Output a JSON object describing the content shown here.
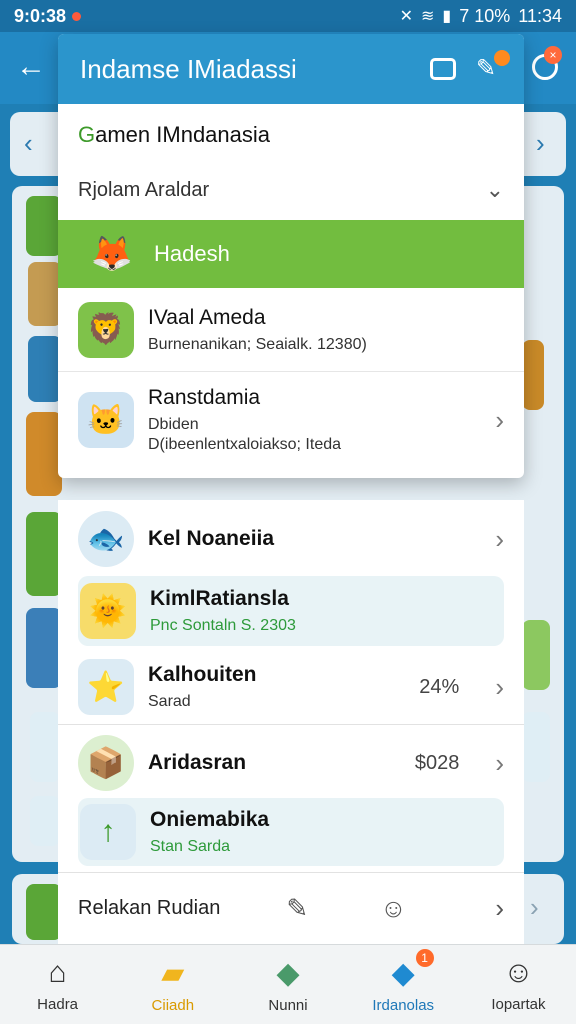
{
  "status_bar": {
    "time_left": "9:0:38",
    "battery": "7 10%",
    "time_right": "11:34",
    "notification_dot_color": "#ff5a3c"
  },
  "header": {
    "title": "Indamse IMiadassi"
  },
  "modal": {
    "subtitle_first": "G",
    "subtitle_rest": "amen IMndanasia",
    "dropdown_label": "Rjolam Araldar",
    "selected_row": {
      "label": "Hadesh",
      "icon": "fox-character-icon"
    },
    "rows": [
      {
        "title": "IVaal Ameda",
        "subtitle": "Burnenanikan; Seaialk. 12380)",
        "icon": "lion-character-icon",
        "bg": "#7fc24a"
      },
      {
        "title": "Ranstdamia",
        "subtitle": "Dbiden",
        "subtitle2": "D(ibeenlentxaloiakso; Iteda",
        "icon": "cat-character-icon",
        "bg": "#cfe3f2"
      }
    ]
  },
  "list": {
    "rows": [
      {
        "title": "Kel Noaneiia",
        "icon": "fish-character-icon"
      },
      {
        "title": "KimlRatiansla",
        "subtitle": "Pnc Sontaln S. 2303",
        "icon": "sun-character-icon"
      },
      {
        "title": "Kalhouiten",
        "subtitle": "Sarad",
        "value": "24%",
        "icon": "star-character-icon"
      },
      {
        "title": "Aridasran",
        "value": "$028",
        "icon": "box-icon"
      },
      {
        "title": "Oniemabika",
        "subtitle": "Stan Sarda",
        "icon": "arrow-up-icon"
      }
    ],
    "footer_label": "Relakan Rudian"
  },
  "bottom_nav": [
    {
      "label": "Hadra",
      "icon": "home-icon"
    },
    {
      "label": "Ciiadh",
      "icon": "folder-icon"
    },
    {
      "label": "Nunni",
      "icon": "cube-icon"
    },
    {
      "label": "Irdanolas",
      "icon": "blue-box-icon",
      "badge": "1"
    },
    {
      "label": "Iopartak",
      "icon": "user-icon"
    }
  ],
  "colors": {
    "primary_blue": "#2b95cc",
    "green": "#72bd3f",
    "accent_orange": "#ff6a2a"
  }
}
